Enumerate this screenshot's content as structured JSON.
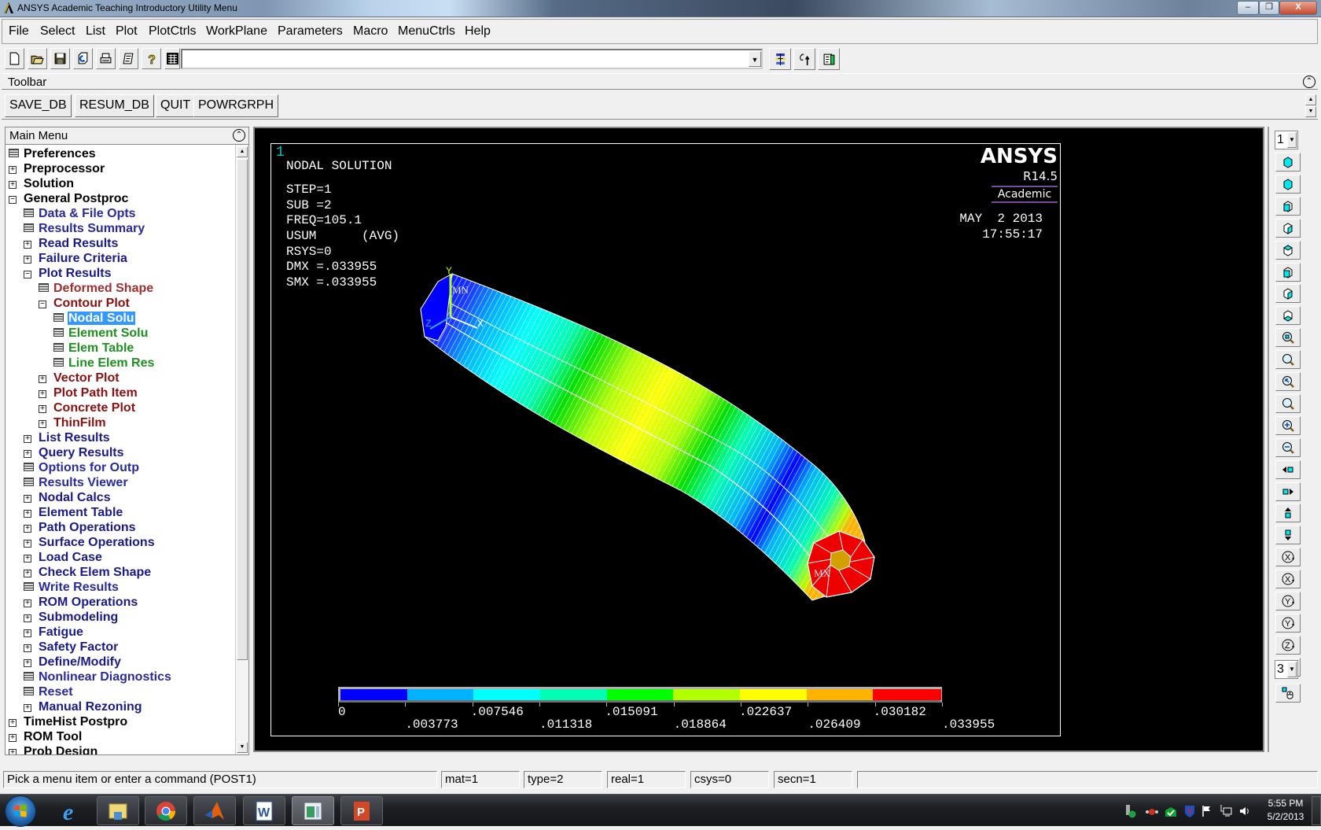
{
  "window": {
    "title": "ANSYS Academic Teaching Introductory Utility Menu",
    "controls": {
      "minimize": "–",
      "restore": "❐",
      "close": "X"
    }
  },
  "menubar": [
    "File",
    "Select",
    "List",
    "Plot",
    "PlotCtrls",
    "WorkPlane",
    "Parameters",
    "Macro",
    "MenuCtrls",
    "Help"
  ],
  "icon_toolbar": {
    "buttons": [
      "new-file-icon",
      "open-folder-icon",
      "save-icon",
      "resume-icon",
      "print-icon",
      "report-icon",
      "help-icon"
    ],
    "command_input": {
      "value": "",
      "placeholder": ""
    },
    "right_buttons": [
      "raise-hidden-icon",
      "reset-picking-icon",
      "contact-manager-icon"
    ]
  },
  "toolbar": {
    "label": "Toolbar",
    "buttons": [
      "SAVE_DB",
      "RESUM_DB",
      "QUIT",
      "POWRGRPH"
    ]
  },
  "main_menu": {
    "title": "Main Menu",
    "items": [
      {
        "label": "Preferences",
        "level": 0,
        "type": "leaf",
        "color": "black"
      },
      {
        "label": "Preprocessor",
        "level": 0,
        "type": "collapsed",
        "color": "black"
      },
      {
        "label": "Solution",
        "level": 0,
        "type": "collapsed",
        "color": "black"
      },
      {
        "label": "General Postproc",
        "level": 0,
        "type": "expanded",
        "color": "black"
      },
      {
        "label": "Data & File Opts",
        "level": 1,
        "type": "leaf",
        "color": "blue2"
      },
      {
        "label": "Results Summary",
        "level": 1,
        "type": "leaf",
        "color": "blue2"
      },
      {
        "label": "Read Results",
        "level": 1,
        "type": "collapsed",
        "color": "blue"
      },
      {
        "label": "Failure Criteria",
        "level": 1,
        "type": "collapsed",
        "color": "blue"
      },
      {
        "label": "Plot Results",
        "level": 1,
        "type": "expanded",
        "color": "blue"
      },
      {
        "label": "Deformed Shape",
        "level": 2,
        "type": "leaf",
        "color": "red2"
      },
      {
        "label": "Contour Plot",
        "level": 2,
        "type": "expanded",
        "color": "red"
      },
      {
        "label": "Nodal Solu",
        "level": 3,
        "type": "leaf",
        "color": "green",
        "selected": true
      },
      {
        "label": "Element Solu",
        "level": 3,
        "type": "leaf",
        "color": "green"
      },
      {
        "label": "Elem Table",
        "level": 3,
        "type": "leaf",
        "color": "green"
      },
      {
        "label": "Line Elem Res",
        "level": 3,
        "type": "leaf",
        "color": "green"
      },
      {
        "label": "Vector Plot",
        "level": 2,
        "type": "collapsed",
        "color": "red"
      },
      {
        "label": "Plot Path Item",
        "level": 2,
        "type": "collapsed",
        "color": "red"
      },
      {
        "label": "Concrete Plot",
        "level": 2,
        "type": "collapsed",
        "color": "red"
      },
      {
        "label": "ThinFilm",
        "level": 2,
        "type": "collapsed",
        "color": "red"
      },
      {
        "label": "List Results",
        "level": 1,
        "type": "collapsed",
        "color": "blue"
      },
      {
        "label": "Query Results",
        "level": 1,
        "type": "collapsed",
        "color": "blue"
      },
      {
        "label": "Options for Outp",
        "level": 1,
        "type": "leaf",
        "color": "blue2"
      },
      {
        "label": "Results Viewer",
        "level": 1,
        "type": "leaf",
        "color": "blue2"
      },
      {
        "label": "Nodal Calcs",
        "level": 1,
        "type": "collapsed",
        "color": "blue"
      },
      {
        "label": "Element Table",
        "level": 1,
        "type": "collapsed",
        "color": "blue"
      },
      {
        "label": "Path Operations",
        "level": 1,
        "type": "collapsed",
        "color": "blue"
      },
      {
        "label": "Surface Operations",
        "level": 1,
        "type": "collapsed",
        "color": "blue"
      },
      {
        "label": "Load Case",
        "level": 1,
        "type": "collapsed",
        "color": "blue"
      },
      {
        "label": "Check Elem Shape",
        "level": 1,
        "type": "collapsed",
        "color": "blue"
      },
      {
        "label": "Write Results",
        "level": 1,
        "type": "leaf",
        "color": "blue2"
      },
      {
        "label": "ROM Operations",
        "level": 1,
        "type": "collapsed",
        "color": "blue"
      },
      {
        "label": "Submodeling",
        "level": 1,
        "type": "collapsed",
        "color": "blue"
      },
      {
        "label": "Fatigue",
        "level": 1,
        "type": "collapsed",
        "color": "blue"
      },
      {
        "label": "Safety Factor",
        "level": 1,
        "type": "collapsed",
        "color": "blue"
      },
      {
        "label": "Define/Modify",
        "level": 1,
        "type": "collapsed",
        "color": "blue"
      },
      {
        "label": "Nonlinear Diagnostics",
        "level": 1,
        "type": "leaf",
        "color": "blue2"
      },
      {
        "label": "Reset",
        "level": 1,
        "type": "leaf",
        "color": "blue2"
      },
      {
        "label": "Manual Rezoning",
        "level": 1,
        "type": "collapsed",
        "color": "blue"
      },
      {
        "label": "TimeHist Postpro",
        "level": 0,
        "type": "collapsed",
        "color": "black"
      },
      {
        "label": "ROM Tool",
        "level": 0,
        "type": "collapsed",
        "color": "black"
      },
      {
        "label": "Prob Design",
        "level": 0,
        "type": "collapsed",
        "color": "black"
      }
    ]
  },
  "graphics": {
    "window_number": "1",
    "header": "NODAL SOLUTION",
    "info_lines": [
      "STEP=1",
      "SUB =2",
      "FREQ=105.1",
      "USUM      (AVG)",
      "RSYS=0",
      "DMX =.033955",
      "SMX =.033955"
    ],
    "logo": "ANSYS",
    "version": "R14.5",
    "edition": "Academic",
    "date": "MAY  2 2013",
    "time": "17:55:17",
    "triad_labels": {
      "x": "X",
      "y": "Y",
      "z": "Z"
    },
    "min_label": "MN",
    "max_label": "MX",
    "legend": {
      "colors": [
        "#0000ff",
        "#00b2ff",
        "#00ffff",
        "#00ffb2",
        "#00ff00",
        "#b2ff00",
        "#ffff00",
        "#ffb200",
        "#ff0000"
      ],
      "values_top": [
        "0",
        ".007546",
        ".015091",
        ".022637",
        ".030182"
      ],
      "values_bottom": [
        ".003773",
        ".011318",
        ".018864",
        ".026409",
        ".033955"
      ]
    }
  },
  "right_toolbar": {
    "window_select": "1",
    "rotate_increment": "3",
    "buttons": [
      "iso-view-icon",
      "oblique-view-icon",
      "front-view-icon",
      "top-view-icon",
      "back-view-icon",
      "bottom-view-icon",
      "right-view-icon",
      "left-view-icon",
      "fit-view-icon",
      "zoom-icon",
      "box-zoom-icon",
      "back-up-icon",
      "zoom-in-icon",
      "zoom-out-icon",
      "pan-left-icon",
      "pan-right-icon",
      "pan-up-icon",
      "pan-down-icon",
      "rotate-x-plus-icon",
      "rotate-x-minus-icon",
      "rotate-y-plus-icon",
      "rotate-y-minus-icon",
      "rotate-z-plus-icon",
      "rotate-z-minus-icon"
    ],
    "dynamic_mode": "dynamic-mode-icon"
  },
  "status_bar": {
    "prompt": "Pick a menu item or enter a command (POST1)",
    "mat": "mat=1",
    "type": "type=2",
    "real": "real=1",
    "csys": "csys=0",
    "secn": "secn=1"
  },
  "taskbar": {
    "apps": [
      "start-button",
      "internet-explorer",
      "file-explorer",
      "chrome",
      "matlab",
      "word",
      "ansys",
      "powerpoint"
    ],
    "clock_time": "5:55 PM",
    "clock_date": "5/2/2013"
  }
}
